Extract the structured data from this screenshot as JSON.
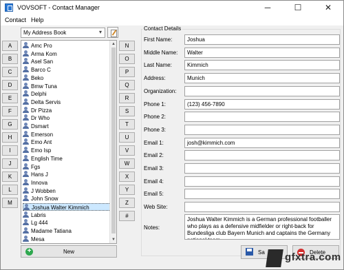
{
  "window": {
    "title": "VOVSOFT - Contact Manager",
    "minimize": "─",
    "maximize": "☐",
    "close": "✕"
  },
  "menu": [
    "Contact",
    "Help"
  ],
  "address_book": {
    "selected": "My Address Book"
  },
  "letters_left": [
    "A",
    "B",
    "C",
    "D",
    "E",
    "F",
    "G",
    "H",
    "I",
    "J",
    "K",
    "L",
    "M"
  ],
  "letters_right": [
    "N",
    "O",
    "P",
    "Q",
    "R",
    "S",
    "T",
    "U",
    "V",
    "W",
    "X",
    "Y",
    "Z",
    "#"
  ],
  "contacts": [
    "Amc Pro",
    "Arma Kom",
    "Asel San",
    "Barco C",
    "Beko",
    "Bmw Tuna",
    "Delphi",
    "Delta Servis",
    "Dr Pizza",
    "Dr Who",
    "Dsmart",
    "Emerson",
    "Emo Ant",
    "Emo Isp",
    "English Time",
    "Fgs",
    "Hans J",
    "Innova",
    "J Wobben",
    "John Snow",
    "Joshua Walter Kimmich",
    "Labris",
    "Lg 444",
    "Madame Tatiana",
    "Mesa"
  ],
  "selected_contact_index": 20,
  "new_button": "New",
  "details": {
    "title": "Contact Details",
    "fields": [
      {
        "label": "First Name:",
        "value": "Joshua"
      },
      {
        "label": "Middle Name:",
        "value": "Walter"
      },
      {
        "label": "Last Name:",
        "value": "Kimmich"
      },
      {
        "label": "Address:",
        "value": "Munich"
      },
      {
        "label": "Organization:",
        "value": ""
      },
      {
        "label": "Phone 1:",
        "value": "(123) 456-7890"
      },
      {
        "label": "Phone 2:",
        "value": ""
      },
      {
        "label": "Phone 3:",
        "value": ""
      },
      {
        "label": "Email 1:",
        "value": "josh@kimmich.com"
      },
      {
        "label": "Email 2:",
        "value": ""
      },
      {
        "label": "Email 3:",
        "value": ""
      },
      {
        "label": "Email 4:",
        "value": ""
      },
      {
        "label": "Email 5:",
        "value": ""
      },
      {
        "label": "Web Site:",
        "value": ""
      }
    ],
    "notes_label": "Notes:",
    "notes": "Joshua Walter Kimmich is a German professional footballer who plays as a defensive midfielder or right-back for Bundesliga club Bayern Munich and captains the Germany national team."
  },
  "buttons": {
    "save": "Sa",
    "delete": "Delete"
  },
  "watermark": "gfxtra.com",
  "colors": {
    "selection": "#cce8ff",
    "save_icon": "#2b5aa8",
    "delete_icon": "#d32f2f",
    "new_icon": "#2fa84f"
  }
}
